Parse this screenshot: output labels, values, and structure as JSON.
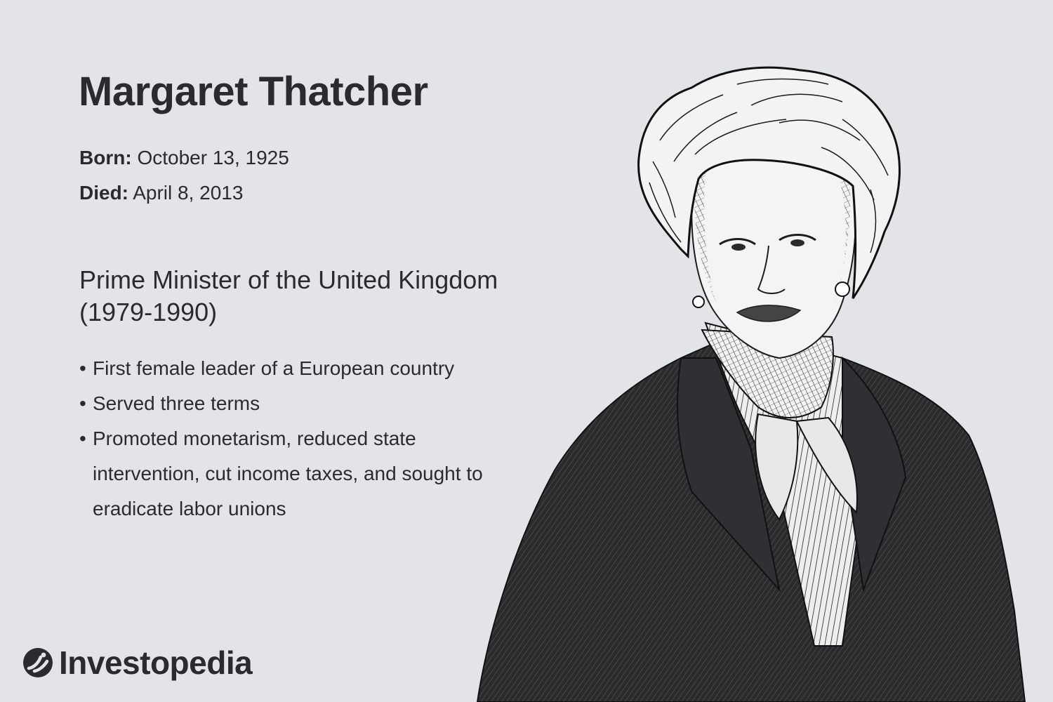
{
  "colors": {
    "background": "#e3e4e8",
    "text": "#2a2b2f",
    "jacket": "#2b2b2e",
    "skin": "#f3f3f3",
    "hair": "#f1f1f1",
    "line": "#1d1d1f"
  },
  "title": "Margaret Thatcher",
  "born": {
    "label": "Born:",
    "value": "October 13, 1925"
  },
  "died": {
    "label": "Died:",
    "value": "April 8, 2013"
  },
  "subtitle": "Prime Minister of the United Kingdom (1979-1990)",
  "bullets": [
    "First female leader of a European country",
    "Served three terms",
    "Promoted monetarism, reduced state intervention, cut income taxes, and sought to eradicate labor unions"
  ],
  "logo": {
    "text": "Investopedia",
    "icon": "investopedia-logo-icon"
  },
  "portrait": {
    "icon": "portrait-illustration"
  }
}
